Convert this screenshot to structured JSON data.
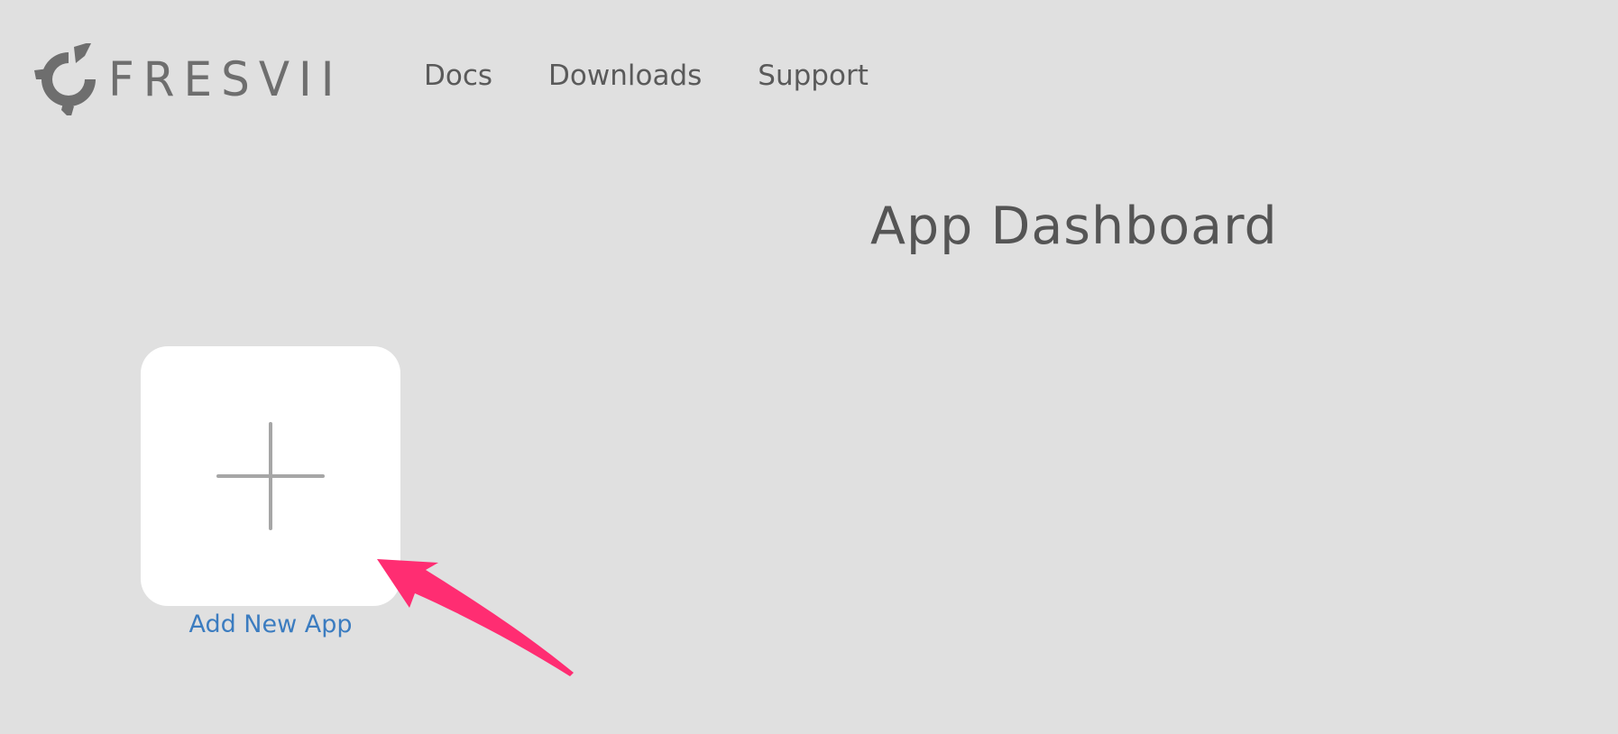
{
  "header": {
    "logo_text": "FRESVII",
    "nav": [
      {
        "label": "Docs"
      },
      {
        "label": "Downloads"
      },
      {
        "label": "Support"
      }
    ]
  },
  "main": {
    "title": "App Dashboard",
    "add_app": {
      "label": "Add New App",
      "icon": "plus-icon"
    }
  },
  "annotation": {
    "arrow_color": "#ff2d72"
  },
  "colors": {
    "background": "#e0e0e0",
    "link": "#3b7cc0",
    "text": "#555555"
  }
}
